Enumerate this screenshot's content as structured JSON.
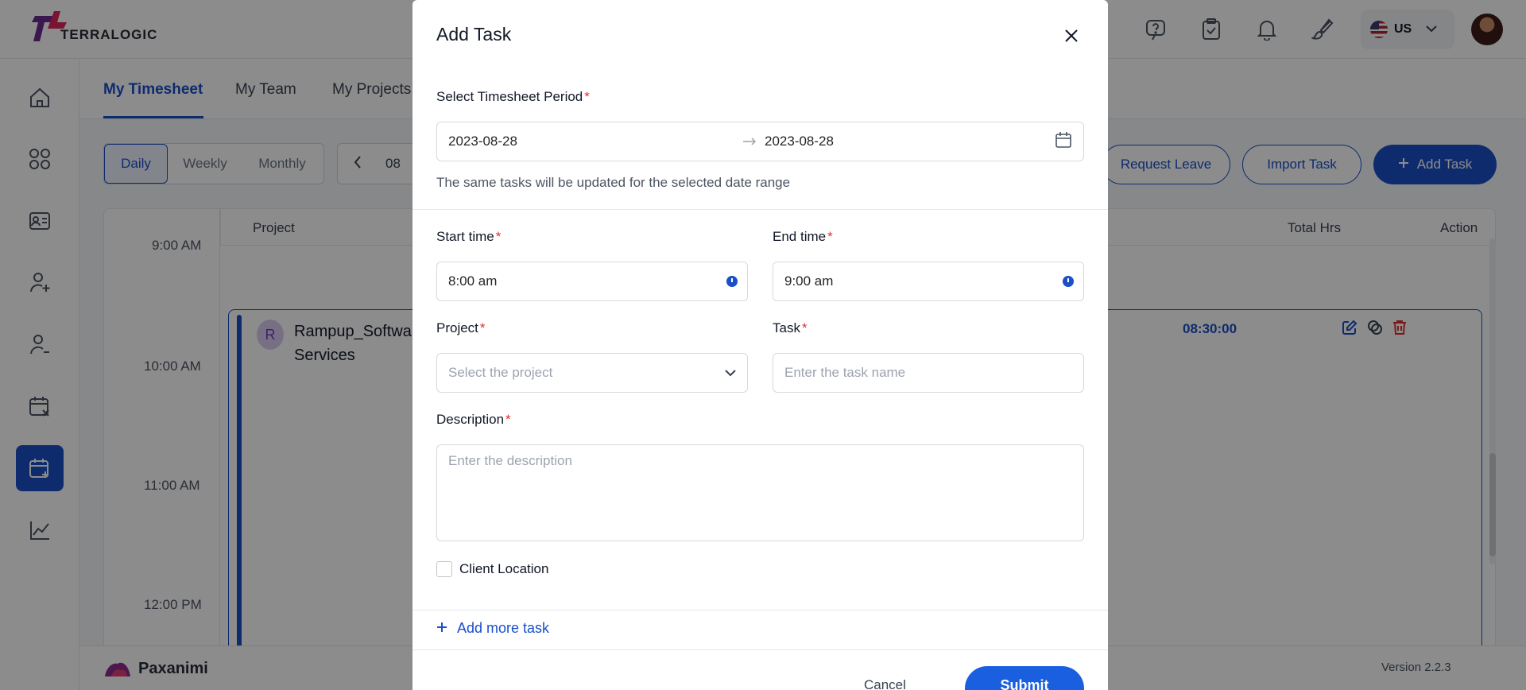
{
  "app": {
    "logo_text": "TERRALOGIC",
    "language": "US",
    "footer_brand": "Paxanimi",
    "version": "Version 2.2.3"
  },
  "tabs": [
    "My Timesheet",
    "My Team",
    "My Projects"
  ],
  "view_modes": [
    "Daily",
    "Weekly",
    "Monthly"
  ],
  "date_nav_text": "08",
  "actions": {
    "request_leave": "Request Leave",
    "import_task": "Import Task",
    "add_task": "Add Task"
  },
  "grid": {
    "headers": {
      "project": "Project",
      "total_hrs": "Total Hrs",
      "action": "Action"
    },
    "time_labels": [
      "9:00 AM",
      "10:00 AM",
      "11:00 AM",
      "12:00 PM"
    ],
    "task": {
      "avatar_letter": "R",
      "name_line1": "Rampup_Softwar",
      "name_line2": "Services",
      "total_hrs": "08:30:00"
    }
  },
  "modal": {
    "title": "Add Task",
    "period_label": "Select Timesheet Period",
    "period_start": "2023-08-28",
    "period_end": "2023-08-28",
    "period_helper": "The same tasks will be updated for the selected date range",
    "start_time_label": "Start time",
    "start_time": "8:00 am",
    "end_time_label": "End time",
    "end_time": "9:00 am",
    "project_label": "Project",
    "project_placeholder": "Select the project",
    "task_label": "Task",
    "task_placeholder": "Enter the task name",
    "description_label": "Description",
    "description_placeholder": "Enter the description",
    "client_location_label": "Client Location",
    "add_more": "Add more task",
    "cancel": "Cancel",
    "submit": "Submit",
    "required_mark": "*"
  },
  "colors": {
    "primary": "#1a4fc9",
    "required": "#e03131",
    "overlay": "rgba(0,0,0,0.45)"
  }
}
